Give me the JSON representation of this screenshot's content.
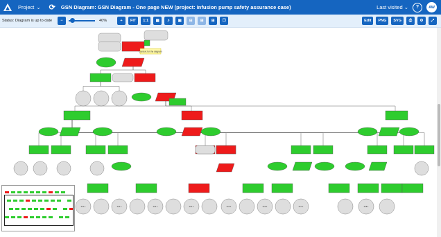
{
  "header": {
    "project_label": "Project",
    "title": "GSN Diagram: GSN Diagram - One page NEW (project: Infusion pump safety assurance case)",
    "last_visited_label": "Last visited",
    "help_label": "?",
    "user_initials": "AW"
  },
  "toolbar": {
    "status_text": "Status: Diagram is up to date",
    "zoom_out": "−",
    "zoom_level": "40%",
    "zoom_in": "+",
    "fit_label": "FIT",
    "one_to_one_label": "1:1",
    "edit_label": "Edit",
    "png_label": "PNG",
    "svg_label": "SVG"
  },
  "diagram": {
    "note_text": "Context for the diagram",
    "solution_labels": [
      "Sn1.1",
      "Sn2.1",
      "Sn3.1",
      "Sn4.1",
      "Sn5.1",
      "Sn6.1",
      "Sn7.1",
      "Sn8.1"
    ]
  },
  "colors": {
    "header_bg": "#1565c0",
    "toolbar_bg": "#e3effb",
    "supported": "#2ecc2e",
    "undeveloped": "#ee1b1b",
    "context": "#dedede"
  }
}
